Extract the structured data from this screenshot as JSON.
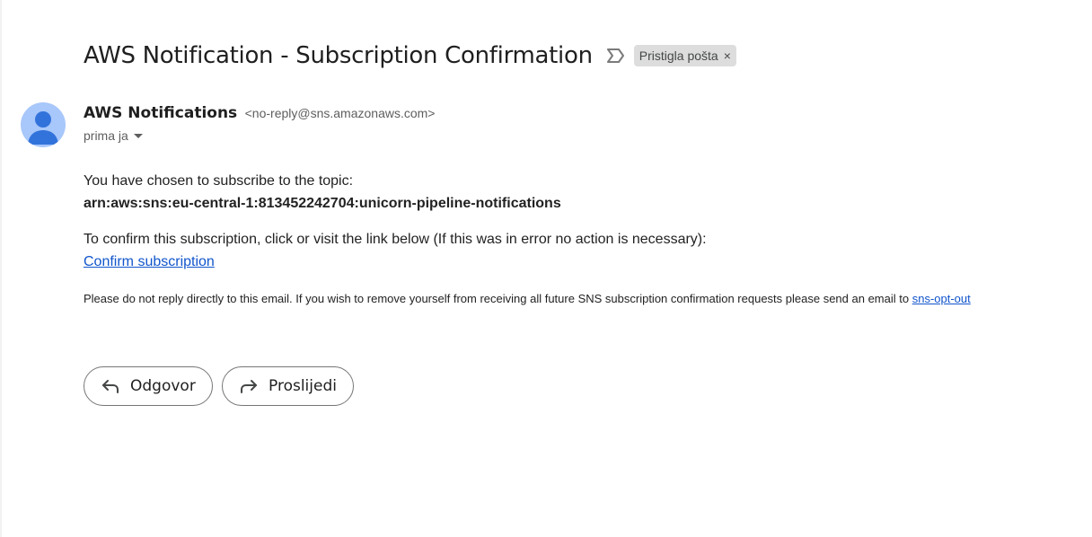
{
  "email": {
    "subject": "AWS Notification - Subscription Confirmation",
    "label_chip": "Pristigla pošta",
    "label_chip_close": "×",
    "sender": {
      "name": "AWS Notifications",
      "address": "<no-reply@sns.amazonaws.com>",
      "recipient_line": "prima ja"
    },
    "body": {
      "intro": "You have chosen to subscribe to the topic:",
      "topic_arn": "arn:aws:sns:eu-central-1:813452242704:unicorn-pipeline-notifications",
      "confirm_instruction": "To confirm this subscription, click or visit the link below (If this was in error no action is necessary):",
      "confirm_link": "Confirm subscription",
      "note": "Please do not reply directly to this email. If you wish to remove yourself from receiving all future SNS subscription confirmation requests please send an email to ",
      "opt_out_link": "sns-opt-out"
    }
  },
  "actions": {
    "reply_label": "Odgovor",
    "forward_label": "Proslijedi"
  },
  "icons": {
    "importance": "importance-marker-icon",
    "avatar": "person-avatar-icon",
    "dropdown": "dropdown-arrow-icon",
    "reply": "reply-arrow-icon",
    "forward": "forward-arrow-icon"
  },
  "colors": {
    "link": "#1155cc",
    "avatar_bg": "#a8c7fa",
    "avatar_fg": "#0b57d0",
    "chip_bg": "#dddddd"
  }
}
